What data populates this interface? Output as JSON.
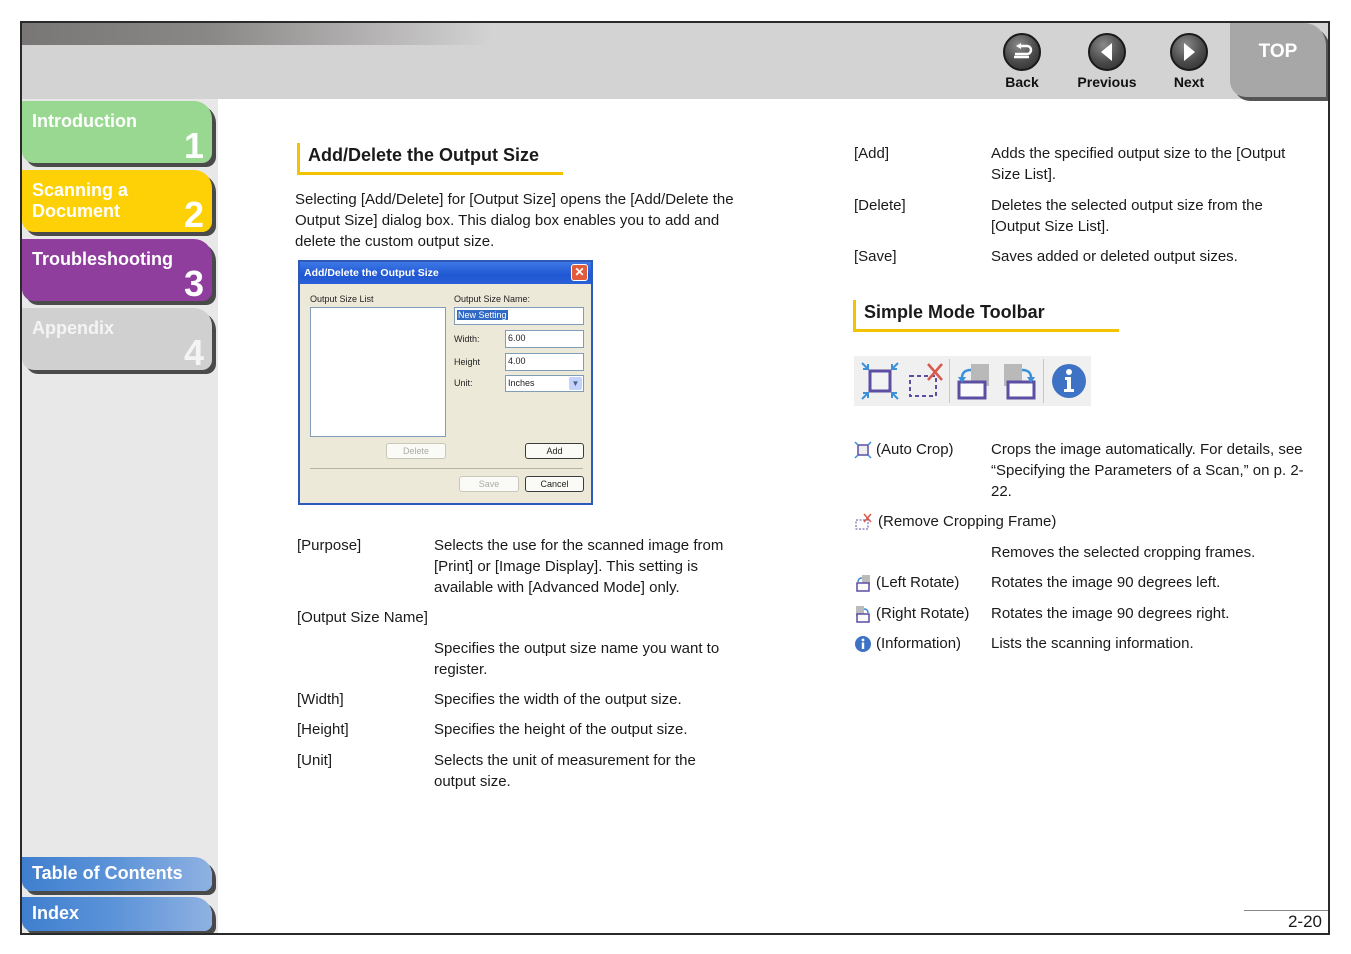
{
  "header": {
    "nav": [
      {
        "label": "Back",
        "icon": "back-arrow-icon"
      },
      {
        "label": "Previous",
        "icon": "left-triangle-icon"
      },
      {
        "label": "Next",
        "icon": "right-triangle-icon"
      }
    ],
    "top_label": "TOP"
  },
  "sidebar": {
    "chapters": [
      {
        "label": "Introduction",
        "number": "1",
        "color": "#99d890"
      },
      {
        "label": "Scanning a Document",
        "number": "2",
        "color": "#fdd106"
      },
      {
        "label": "Troubleshooting",
        "number": "3",
        "color": "#8f3e9e"
      },
      {
        "label": "Appendix",
        "number": "4",
        "color": "#d0d0d0"
      }
    ],
    "toc_label": "Table of Contents",
    "index_label": "Index"
  },
  "left": {
    "title": "Add/Delete the Output Size",
    "intro": "Selecting [Add/Delete] for [Output Size] opens the [Add/Delete the Output Size] dialog box. This dialog box enables you to add and delete the custom output size.",
    "dialog": {
      "title": "Add/Delete the Output Size",
      "list_label": "Output Size List",
      "name_label": "Output Size Name:",
      "name_value": "New Setting",
      "width_label": "Width:",
      "width_value": "6.00",
      "height_label": "Height",
      "height_value": "4.00",
      "unit_label": "Unit:",
      "unit_value": "Inches",
      "delete_label": "Delete",
      "add_label": "Add",
      "save_label": "Save",
      "cancel_label": "Cancel"
    },
    "definitions": [
      {
        "term": "[Purpose]",
        "desc": "Selects the use for the scanned image from [Print] or [Image Display]. This setting is available with [Advanced Mode] only."
      },
      {
        "term": "[Output Size Name]",
        "desc": "Specifies the output size name you want to register."
      },
      {
        "term": "[Width]",
        "desc": "Specifies the width of the output size."
      },
      {
        "term": "[Height]",
        "desc": "Specifies the height of the output size."
      },
      {
        "term": "[Unit]",
        "desc": "Selects the unit of measurement for the output size."
      }
    ]
  },
  "right": {
    "definitions": [
      {
        "term": "[Add]",
        "desc": "Adds the specified output size to the [Output Size List]."
      },
      {
        "term": "[Delete]",
        "desc": "Deletes the selected output size from the [Output Size List]."
      },
      {
        "term": "[Save]",
        "desc": "Saves added or deleted output sizes."
      }
    ],
    "toolbar_title": "Simple Mode Toolbar",
    "tools": [
      {
        "term": "(Auto Crop)",
        "icon": "auto-crop-icon",
        "desc": "Crops the image automatically. For details, see “Specifying the Parameters of a Scan,” on p. 2-22."
      },
      {
        "term": "(Remove Cropping Frame)",
        "icon": "remove-crop-frame-icon",
        "desc": "Removes the selected cropping frames."
      },
      {
        "term": "(Left Rotate)",
        "icon": "rotate-left-icon",
        "desc": "Rotates the image 90 degrees left."
      },
      {
        "term": "(Right Rotate)",
        "icon": "rotate-right-icon",
        "desc": "Rotates the image 90 degrees right."
      },
      {
        "term": "(Information)",
        "icon": "information-icon",
        "desc": "Lists the scanning information."
      }
    ]
  },
  "footer": {
    "page_number": "2-20"
  }
}
